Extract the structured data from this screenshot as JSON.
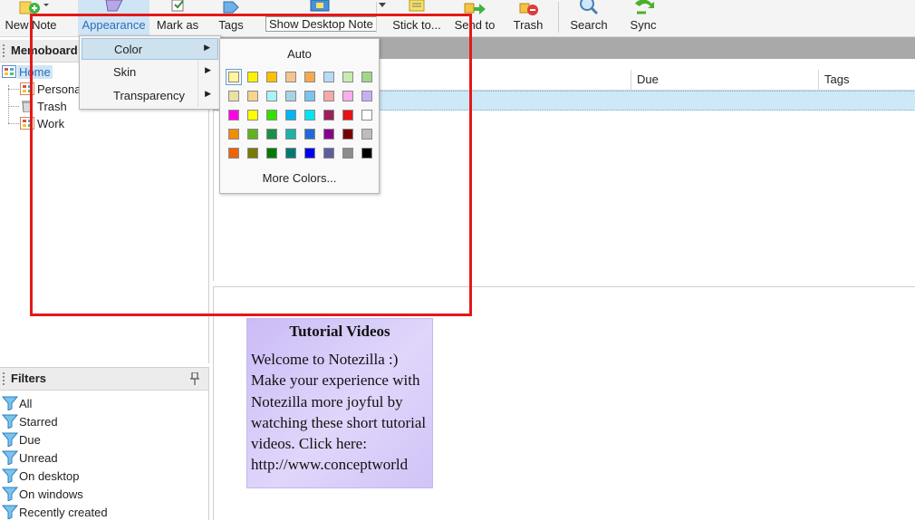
{
  "toolbar": {
    "new_note": "New Note",
    "appearance": "Appearance",
    "mark_as": "Mark as",
    "tags": "Tags",
    "show_desktop_note": "Show Desktop Note",
    "stick_to": "Stick to...",
    "send_to": "Send to",
    "trash": "Trash",
    "search": "Search",
    "sync": "Sync"
  },
  "sidebar": {
    "title": "Memoboard",
    "items": [
      {
        "label": "Home",
        "icon": "memoboard-icon",
        "selected": true
      },
      {
        "label": "Personal",
        "icon": "memoboard-icon"
      },
      {
        "label": "Trash",
        "icon": "trash-bin-icon"
      },
      {
        "label": "Work",
        "icon": "memoboard-icon"
      }
    ]
  },
  "filters": {
    "title": "Filters",
    "items": [
      "All",
      "Starred",
      "Due",
      "Unread",
      "On desktop",
      "On windows",
      "Recently created"
    ]
  },
  "columns": [
    "Due",
    "Tags"
  ],
  "appearance_menu": {
    "items": [
      "Color",
      "Skin",
      "Transparency"
    ],
    "highlighted": "Color"
  },
  "color_menu": {
    "auto_label": "Auto",
    "more_label": "More Colors...",
    "rows": [
      [
        "#fff59a",
        "#fff200",
        "#ffc000",
        "#f4c48e",
        "#f5a94e",
        "#b5dcf5",
        "#c8ecaf",
        "#9ed889"
      ],
      [
        "#ece1a4",
        "#f8d48e",
        "#a9f3f7",
        "#a7d3e6",
        "#7cc3ec",
        "#f5a9a9",
        "#f7aeea",
        "#c4b0f2"
      ],
      [
        "#ff00e6",
        "#ffff00",
        "#33e000",
        "#00b5f2",
        "#00e5f2",
        "#9b1f5c",
        "#e81010",
        "#ffffff"
      ],
      [
        "#f28c00",
        "#62b220",
        "#1a8f48",
        "#1bb3a6",
        "#1f6ad9",
        "#8a008a",
        "#7a0000",
        "#bdbdbd"
      ],
      [
        "#ef6400",
        "#7a7a00",
        "#007a00",
        "#007a70",
        "#0000ee",
        "#5e5e9e",
        "#8c8c8c",
        "#000000"
      ]
    ]
  },
  "note": {
    "title": "Tutorial Videos",
    "body": "Welcome to Notezilla :) Make your experience with Notezilla more joyful by watching these short tutorial videos. Click here:",
    "link": "http://www.conceptworld",
    "color": "#d3c6f8"
  }
}
